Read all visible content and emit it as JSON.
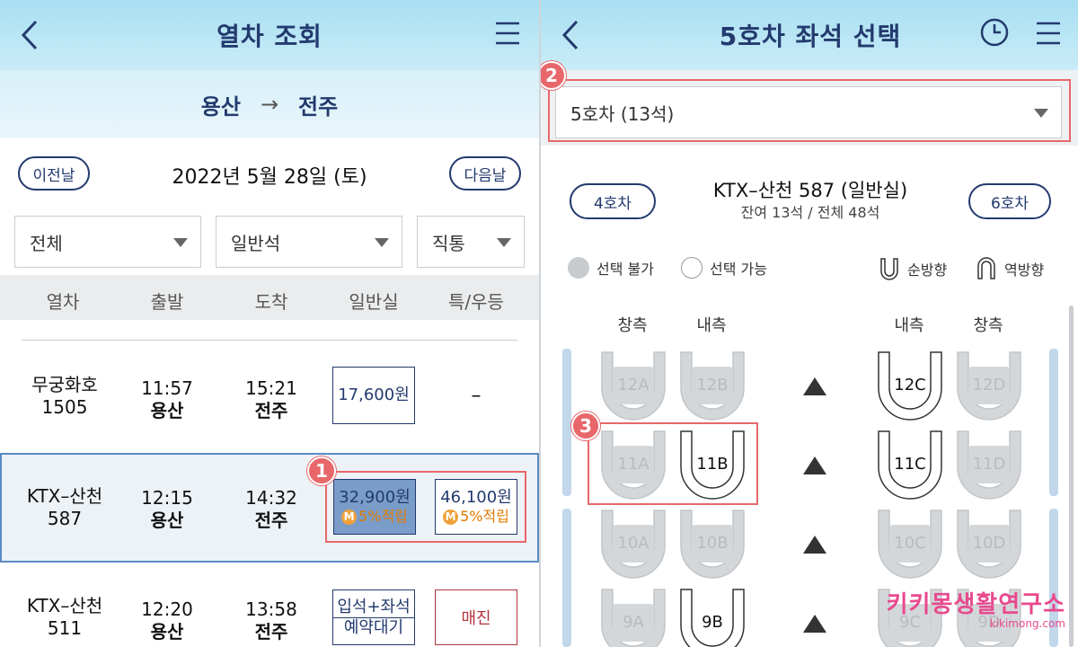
{
  "left": {
    "title": "열차 조회",
    "route": {
      "from": "용산",
      "arrow": "→",
      "to": "전주"
    },
    "prev_day": "이전날",
    "next_day": "다음날",
    "date": "2022년 5월 28일 (토)",
    "filters": [
      "전체",
      "일반석",
      "직통"
    ],
    "columns": [
      "열차",
      "출발",
      "도착",
      "일반실",
      "특/우등"
    ],
    "rows": [
      {
        "train": "무궁화호",
        "num": "1505",
        "dep_time": "11:57",
        "dep_st": "용산",
        "arr_time": "15:21",
        "arr_st": "전주",
        "general": "17,600원",
        "special": "–"
      },
      {
        "train": "KTX–산천",
        "num": "587",
        "dep_time": "12:15",
        "dep_st": "용산",
        "arr_time": "14:32",
        "arr_st": "전주",
        "general": "32,900원",
        "general_mile": "5%적립",
        "special": "46,100원",
        "special_mile": "5%적립"
      },
      {
        "train": "KTX–산천",
        "num": "511",
        "dep_time": "12:20",
        "dep_st": "용산",
        "arr_time": "13:58",
        "arr_st": "전주",
        "general_1": "입석+좌석",
        "general_2": "예약대기",
        "special": "매진"
      }
    ],
    "mile_badge": "M"
  },
  "right": {
    "title": "5호차 좌석 선택",
    "car_select": "5호차 (13석)",
    "prev_car": "4호차",
    "next_car": "6호차",
    "train_name": "KTX–산천 587 (일반실)",
    "remaining": "잔여 13석 / 전체 48석",
    "legend": {
      "unavailable": "선택 불가",
      "available": "선택 가능",
      "forward": "순방향",
      "reverse": "역방향"
    },
    "col_heads": [
      "창측",
      "내측",
      "내측",
      "창측"
    ],
    "seats": {
      "r12": [
        "12A",
        "12B",
        "12C",
        "12D"
      ],
      "r11": [
        "11A",
        "11B",
        "11C",
        "11D"
      ],
      "r10": [
        "10A",
        "10B",
        "10C",
        "10D"
      ],
      "r9": [
        "9A",
        "9B",
        "9C",
        "9D"
      ]
    }
  },
  "callouts": [
    "1",
    "2",
    "3"
  ],
  "watermark": {
    "main": "키키몽생활연구소",
    "sub": "kikimong.com"
  },
  "colors": {
    "navy": "#233a6e",
    "accent_red": "#e8676a",
    "mileage": "#e07a00",
    "selected_fill": "#7a9cc9",
    "soldout": "#b3333c"
  }
}
